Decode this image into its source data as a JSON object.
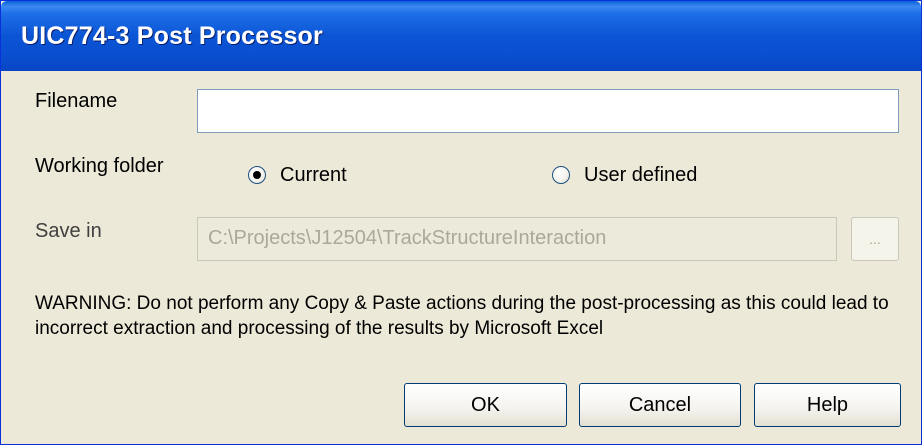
{
  "window": {
    "title": "UIC774-3 Post Processor"
  },
  "form": {
    "filename_label": "Filename",
    "filename_value": "",
    "working_folder_label": "Working folder",
    "radio_current_label": "Current",
    "radio_user_label": "User defined",
    "save_in_label": "Save in",
    "save_in_value": "C:\\Projects\\J12504\\TrackStructureInteraction",
    "browse_label": "..."
  },
  "warning_text": "WARNING: Do not perform any Copy & Paste actions during the post-processing as this could lead to incorrect extraction and processing of the results by Microsoft Excel",
  "buttons": {
    "ok": "OK",
    "cancel": "Cancel",
    "help": "Help"
  },
  "colors": {
    "titlebar": "#0a4ed0",
    "dialog_bg": "#ece9d8",
    "button_border": "#003c74"
  }
}
